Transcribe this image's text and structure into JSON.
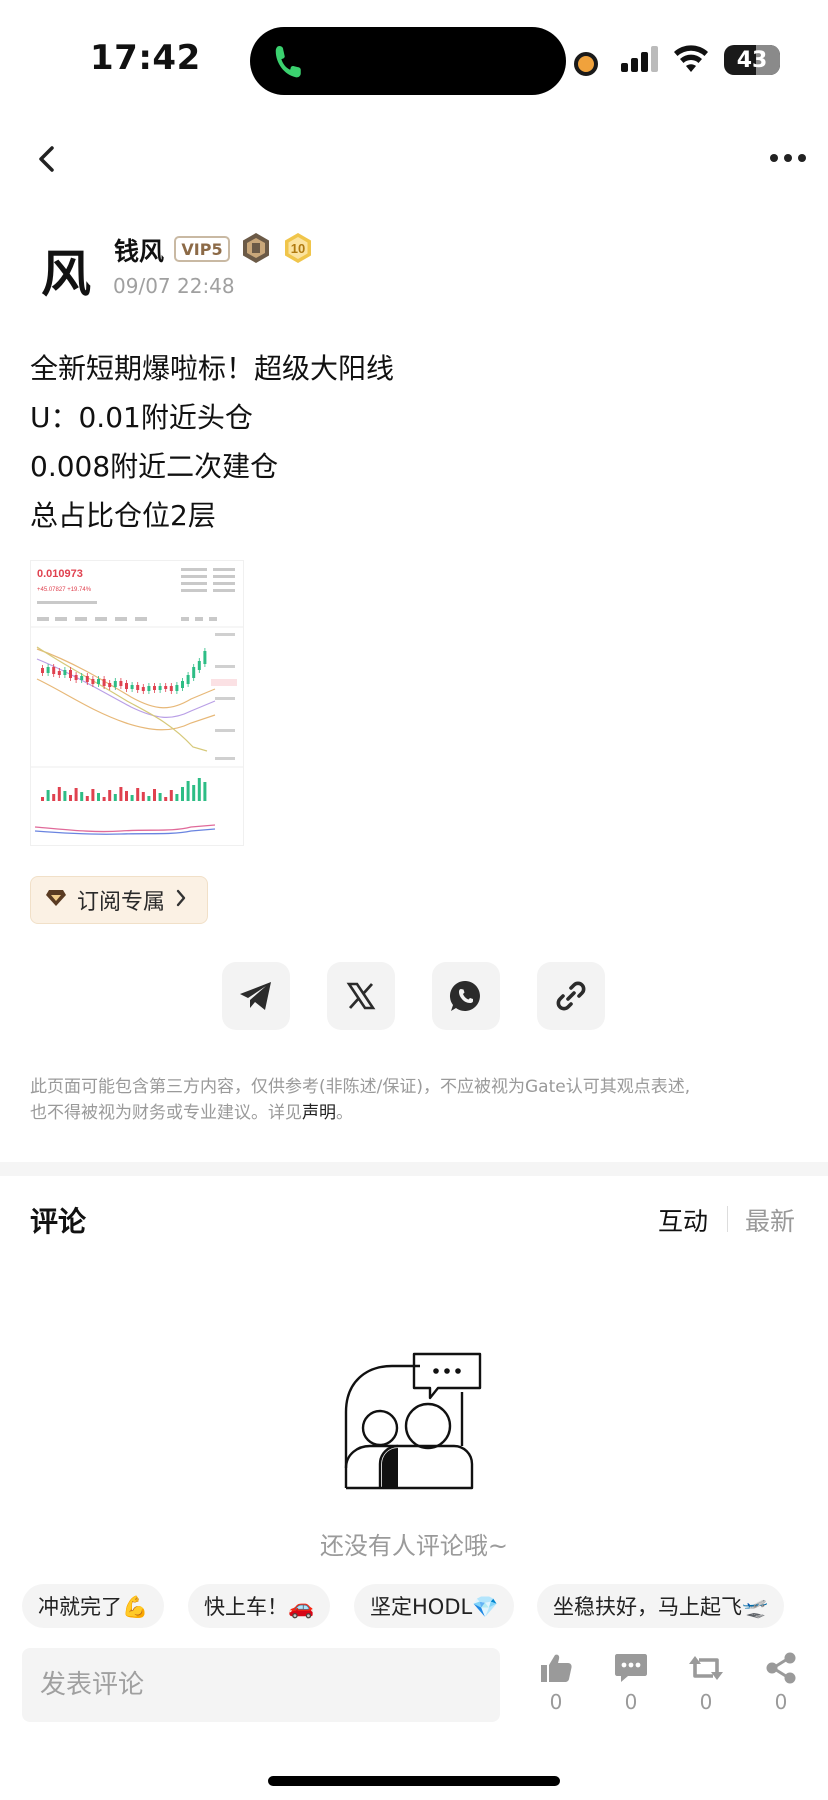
{
  "status_bar": {
    "time": "17:42",
    "battery": "43"
  },
  "nav": {
    "back_icon": "chevron-left-icon",
    "more_icon": "more-horizontal-icon"
  },
  "post": {
    "author": {
      "avatar_char": "风",
      "name": "钱风",
      "vip_badge": "VIP5",
      "level_badge": "10"
    },
    "timestamp": "09/07 22:48",
    "lines": [
      "全新短期爆啦标！超级大阳线",
      "U：0.01附近头仓",
      "0.008附近二次建仓",
      "总占比仓位2层"
    ],
    "image": {
      "price": "0.010973",
      "change": "+45.07827 +19.74%"
    }
  },
  "subscribe": {
    "label": "订阅专属"
  },
  "share": {
    "icons": [
      "telegram-icon",
      "x-icon",
      "whatsapp-icon",
      "link-icon"
    ]
  },
  "disclaimer": {
    "line1": "此页面可能包含第三方内容，仅供参考(非陈述/保证)，不应被视为Gate认可其观点表述,",
    "line2_prefix": "也不得被视为财务或专业建议。详见",
    "link": "声明",
    "line2_suffix": "。"
  },
  "comments": {
    "title": "评论",
    "sort": {
      "hot": "互动",
      "new": "最新"
    },
    "empty_text": "还没有人评论哦~",
    "quick_replies": [
      "冲就完了💪",
      "快上车！🚗",
      "坚定HODL💎",
      "坐稳扶好，马上起飞🛫"
    ],
    "input_placeholder": "发表评论",
    "actions": [
      {
        "icon": "thumbs-up-icon",
        "count": "0"
      },
      {
        "icon": "comment-icon",
        "count": "0"
      },
      {
        "icon": "repost-icon",
        "count": "0"
      },
      {
        "icon": "share-icon",
        "count": "0"
      }
    ]
  },
  "colors": {
    "accent_gold": "#f0c54a",
    "vip_text": "#8c6a47",
    "muted_text": "#9a9a9a",
    "subscribe_bg": "#fbf1e4"
  }
}
